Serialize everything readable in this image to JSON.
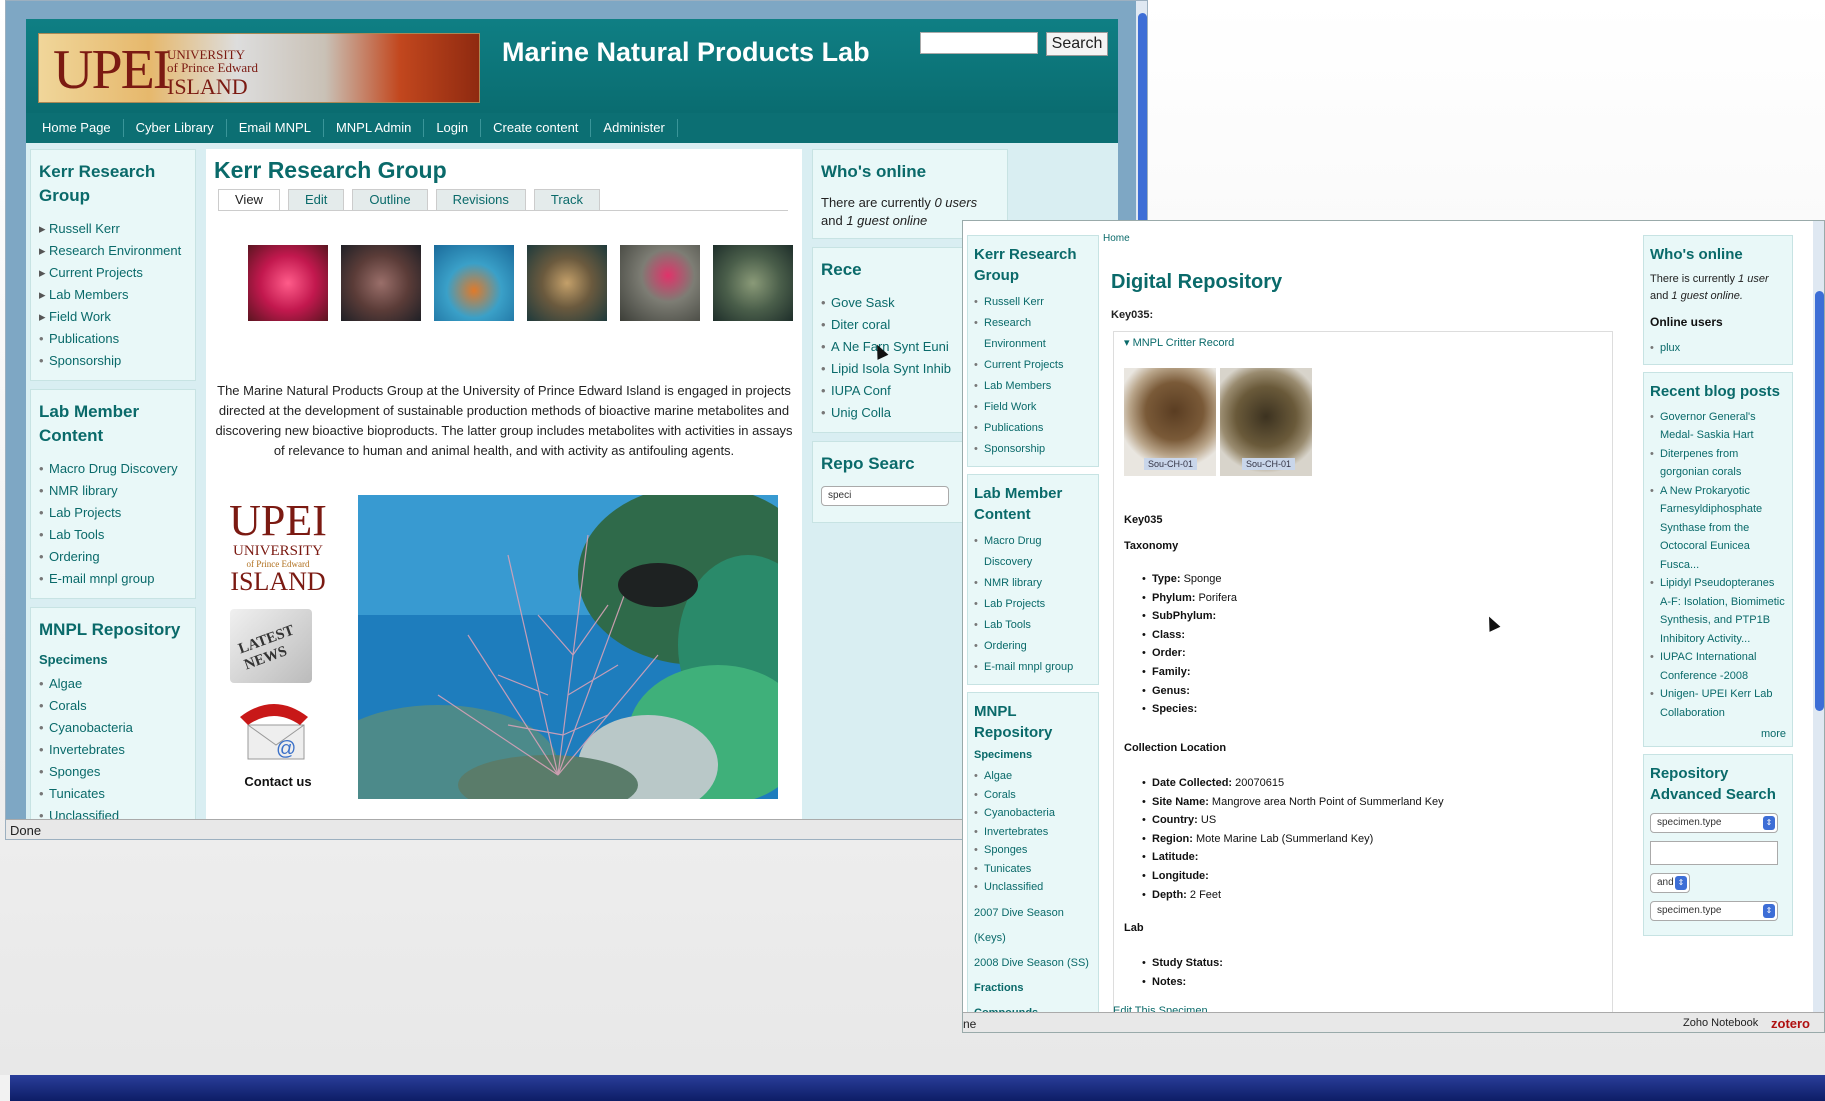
{
  "window1": {
    "site_title": "Marine Natural Products Lab",
    "logo": {
      "main": "UPEI",
      "university": "UNIVERSITY",
      "of": "of Prince Edward",
      "island": "ISLAND"
    },
    "search": {
      "button": "Search",
      "value": ""
    },
    "nav": [
      "Home Page",
      "Cyber Library",
      "Email MNPL",
      "MNPL Admin",
      "Login",
      "Create content",
      "Administer"
    ],
    "left": {
      "kerr": {
        "title": "Kerr Research Group",
        "items": [
          "Russell Kerr",
          "Research Environment",
          "Current Projects",
          "Lab Members",
          "Field Work",
          "Publications",
          "Sponsorship"
        ]
      },
      "lab": {
        "title": "Lab Member Content",
        "items": [
          "Macro Drug Discovery",
          "NMR library",
          "Lab Projects",
          "Lab Tools",
          "Ordering",
          "E-mail mnpl group"
        ]
      },
      "repo": {
        "title": "MNPL Repository",
        "specimens_heading": "Specimens",
        "items": [
          "Algae",
          "Corals",
          "Cyanobacteria",
          "Invertebrates",
          "Sponges",
          "Tunicates",
          "Unclassified"
        ]
      }
    },
    "main": {
      "title": "Kerr Research Group",
      "tabs": [
        "View",
        "Edit",
        "Outline",
        "Revisions",
        "Track"
      ],
      "intro": "The Marine Natural Products Group at the University of Prince Edward Island is engaged in projects directed at the development of sustainable production methods of bioactive marine metabolites and discovering new bioactive bioproducts. The latter group includes metabolites with activities in assays of relevance to human and animal health, and with activity as antifouling agents.",
      "news_label": "LATEST NEWS",
      "contact": "Contact us"
    },
    "right": {
      "online_title": "Who's online",
      "online_text_1": "There are currently",
      "online_users": "0 users",
      "online_text_2": "and",
      "online_guest": "1 guest online",
      "recent_title": "Rece",
      "recent_items": [
        "Gove Sask",
        "Diter coral",
        "A Ne Farn Synt Euni",
        "Lipid Isola Synt Inhib",
        "IUPA Conf",
        "Unig Colla"
      ],
      "repo_title": "Repo Searc",
      "repo_select": "speci"
    },
    "status": "Done"
  },
  "window2": {
    "breadcrumb": "Home",
    "title": "Digital Repository",
    "key_label": "Key035:",
    "legend": "▾ MNPL Critter Record",
    "photo_label_1": "Sou-CH-01",
    "photo_label_2": "Sou-CH-01",
    "key": "Key035",
    "taxonomy_heading": "Taxonomy",
    "taxonomy": [
      {
        "label": "Type:",
        "value": "Sponge"
      },
      {
        "label": "Phylum:",
        "value": "Porifera"
      },
      {
        "label": "SubPhylum:",
        "value": ""
      },
      {
        "label": "Class:",
        "value": ""
      },
      {
        "label": "Order:",
        "value": ""
      },
      {
        "label": "Family:",
        "value": ""
      },
      {
        "label": "Genus:",
        "value": ""
      },
      {
        "label": "Species:",
        "value": ""
      }
    ],
    "collection_heading": "Collection Location",
    "collection": [
      {
        "label": "Date Collected:",
        "value": "20070615"
      },
      {
        "label": "Site Name:",
        "value": "Mangrove area North Point of Summerland Key"
      },
      {
        "label": "Country:",
        "value": "US"
      },
      {
        "label": "Region:",
        "value": "Mote Marine Lab (Summerland Key)"
      },
      {
        "label": "Latitude:",
        "value": ""
      },
      {
        "label": "Longitude:",
        "value": ""
      },
      {
        "label": "Depth:",
        "value": "2 Feet"
      }
    ],
    "lab_heading": "Lab",
    "lab": [
      {
        "label": "Study Status:",
        "value": ""
      },
      {
        "label": "Notes:",
        "value": ""
      }
    ],
    "edit_link": "Edit This Specimen",
    "left": {
      "kerr": {
        "title": "Kerr Research Group",
        "items": [
          "Russell Kerr",
          "Research Environment",
          "Current Projects",
          "Lab Members",
          "Field Work",
          "Publications",
          "Sponsorship"
        ]
      },
      "lab": {
        "title": "Lab Member Content",
        "items": [
          "Macro Drug Discovery",
          "NMR library",
          "Lab Projects",
          "Lab Tools",
          "Ordering",
          "E-mail mnpl group"
        ]
      },
      "repo": {
        "title": "MNPL Repository",
        "specimens_heading": "Specimens",
        "items": [
          "Algae",
          "Corals",
          "Cyanobacteria",
          "Invertebrates",
          "Sponges",
          "Tunicates",
          "Unclassified"
        ],
        "extra": [
          "2007 Dive Season (Keys)",
          "2008 Dive Season (SS)"
        ],
        "fractions": "Fractions",
        "compounds": "Compounds"
      }
    },
    "right": {
      "online_title": "Who's online",
      "online_text_1": "There is currently",
      "online_users": "1 user",
      "online_text_2": "and",
      "online_guest": "1 guest online.",
      "online_users_heading": "Online users",
      "online_user_list": [
        "plux"
      ],
      "recent_title": "Recent blog posts",
      "recent_items": [
        "Governor General's Medal- Saskia Hart",
        "Diterpenes from gorgonian corals",
        "A New Prokaryotic Farnesyldiphosphate Synthase from the Octocoral Eunicea Fusca...",
        "Lipidyl Pseudopteranes A-F: Isolation, Biomimetic Synthesis, and PTP1B Inhibitory Activity...",
        "IUPAC International Conference -2008",
        "Unigen- UPEI Kerr Lab Collaboration"
      ],
      "more": "more",
      "repo_title": "Repository Advanced Search",
      "select_1": "specimen.type",
      "and": "and",
      "select_2": "specimen.type"
    },
    "status_left": "ne",
    "zoho": "Zoho Notebook",
    "zotero": "zotero"
  }
}
